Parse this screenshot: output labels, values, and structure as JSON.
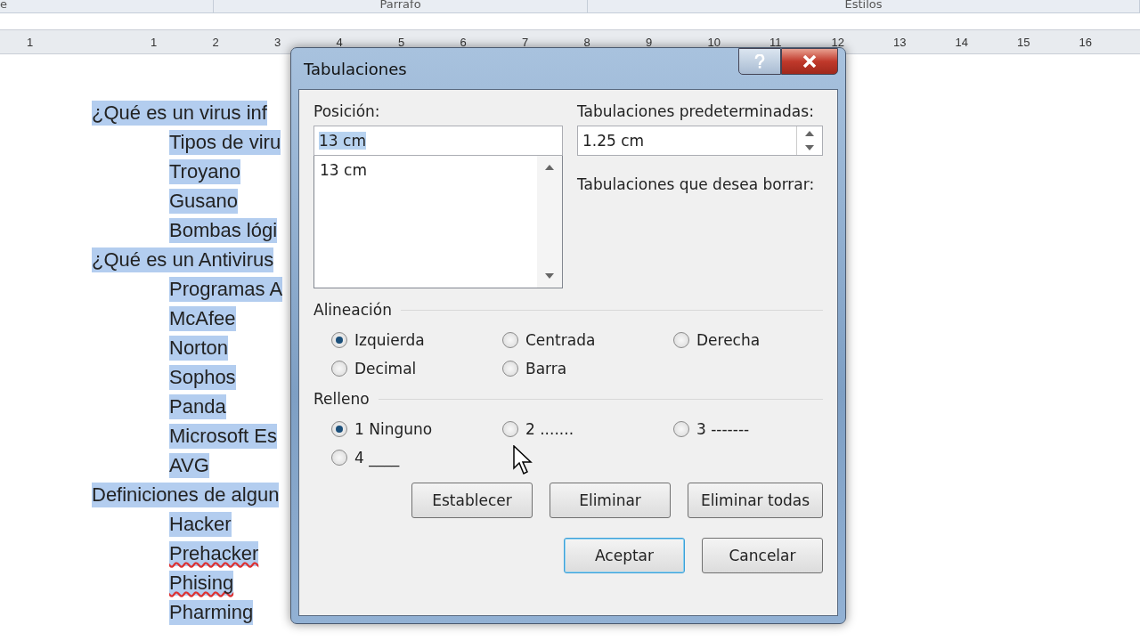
{
  "ribbon": {
    "groups": [
      {
        "label": "e"
      },
      {
        "label": "Parrafo"
      },
      {
        "label": "Estilos"
      }
    ]
  },
  "ruler": {
    "numbers": [
      "1",
      "1",
      "2",
      "3",
      "4",
      "5",
      "6",
      "7",
      "8",
      "9",
      "10",
      "11",
      "12",
      "13",
      "14",
      "15",
      "16"
    ]
  },
  "document": {
    "lines": [
      {
        "text": "¿Qué es un virus inf",
        "kind": "heading",
        "misspelled": false
      },
      {
        "text": "Tipos de viru",
        "kind": "sub",
        "misspelled": false
      },
      {
        "text": "Troyano",
        "kind": "sub",
        "misspelled": false
      },
      {
        "text": "Gusano",
        "kind": "sub",
        "misspelled": false
      },
      {
        "text": "Bombas lógi",
        "kind": "sub",
        "misspelled": false
      },
      {
        "text": "¿Qué es un Antivirus",
        "kind": "heading",
        "misspelled": false
      },
      {
        "text": "Programas A",
        "kind": "sub",
        "misspelled": false
      },
      {
        "text": "McAfee",
        "kind": "sub",
        "misspelled": false
      },
      {
        "text": "Norton",
        "kind": "sub",
        "misspelled": false
      },
      {
        "text": "Sophos",
        "kind": "sub",
        "misspelled": false
      },
      {
        "text": "Panda",
        "kind": "sub",
        "misspelled": false
      },
      {
        "text": "Microsoft Es",
        "kind": "sub",
        "misspelled": false
      },
      {
        "text": "AVG",
        "kind": "sub",
        "misspelled": false
      },
      {
        "text": "Definiciones de algun",
        "kind": "heading",
        "misspelled": false
      },
      {
        "text": "Hacker",
        "kind": "sub",
        "misspelled": false
      },
      {
        "text": "Prehacker",
        "kind": "sub",
        "misspelled": true
      },
      {
        "text": "Phising",
        "kind": "sub",
        "misspelled": true
      },
      {
        "text": "Pharming",
        "kind": "sub",
        "misspelled": false
      }
    ]
  },
  "dialog": {
    "title": "Tabulaciones",
    "position": {
      "label": "Posición:",
      "value": "13 cm",
      "list": [
        "13 cm"
      ]
    },
    "default_tabs": {
      "label": "Tabulaciones predeterminadas:",
      "value": "1.25 cm"
    },
    "clear_label": "Tabulaciones que desea borrar:",
    "alignment": {
      "label": "Alineación",
      "options": [
        {
          "label": "Izquierda",
          "selected": true
        },
        {
          "label": "Centrada",
          "selected": false
        },
        {
          "label": "Derecha",
          "selected": false
        },
        {
          "label": "Decimal",
          "selected": false
        },
        {
          "label": "Barra",
          "selected": false
        }
      ]
    },
    "leader": {
      "label": "Relleno",
      "options": [
        {
          "label": "1 Ninguno",
          "selected": true
        },
        {
          "label": "2 .......",
          "selected": false
        },
        {
          "label": "3 -------",
          "selected": false
        },
        {
          "label": "4 ____",
          "selected": false
        }
      ]
    },
    "action_buttons": [
      "Establecer",
      "Eliminar",
      "Eliminar todas"
    ],
    "buttons": [
      {
        "label": "Aceptar",
        "default": true
      },
      {
        "label": "Cancelar",
        "default": false
      }
    ]
  }
}
